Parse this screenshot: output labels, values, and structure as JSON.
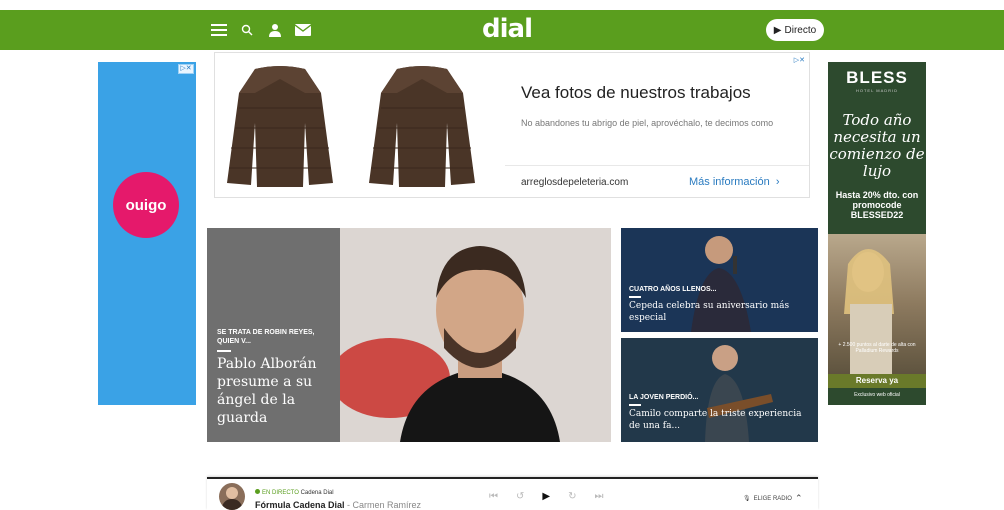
{
  "header": {
    "logo": "dial",
    "directo_label": "Directo",
    "icons": [
      "menu-icon",
      "search-icon",
      "user-icon",
      "mail-icon"
    ],
    "bg_color": "#5a9e1e"
  },
  "ads": {
    "left": {
      "brand": "OUIGO",
      "bg_color": "#3aa2e6",
      "accent": "#e5196b"
    },
    "top": {
      "title": "Vea fotos de nuestros trabajos",
      "description": "No abandones tu abrigo de piel, aprovéchalo, te decimos como",
      "domain": "arreglosdepeleteria.com",
      "cta": "Más información"
    },
    "right": {
      "brand": "BLESS",
      "brand_sub": "HOTEL MADRID",
      "headline": "Todo año necesita un comienzo de lujo",
      "promo": "Hasta 20% dto. con promocode BLESSED22",
      "fine_print": "+ 2.500 puntos al darte de alta con Palladium Rewards",
      "cta": "Reserva ya",
      "note": "Exclusivo web oficial"
    }
  },
  "main": {
    "hero": {
      "kicker": "SE TRATA DE ROBIN REYES, QUIEN V...",
      "headline": "Pablo Alborán presume a su ángel de la guarda"
    },
    "cards": [
      {
        "kicker": "CUATRO AÑOS LLENOS...",
        "headline": "Cepeda celebra su aniversario más especial"
      },
      {
        "kicker": "LA JOVEN PERDIÓ...",
        "headline": "Camilo comparte la triste experiencia de una fa..."
      }
    ]
  },
  "player": {
    "live_tag": "EN DIRECTO",
    "station": "Cadena Dial",
    "program": "Fórmula Cadena Dial",
    "separator": " - ",
    "host": "Carmen Ramírez",
    "elige_label": "ELIGE RADIO"
  }
}
